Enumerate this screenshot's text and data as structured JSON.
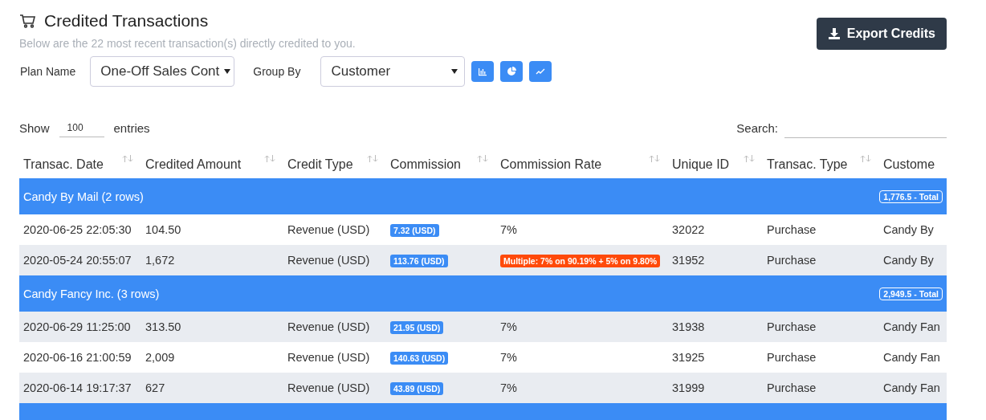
{
  "header": {
    "title": "Credited Transactions",
    "subtitle": "Below are the 22 most recent transaction(s) directly credited to you.",
    "export_button": "Export Credits"
  },
  "filters": {
    "plan_label": "Plan Name",
    "plan_value": "One-Off Sales Cont",
    "group_label": "Group By",
    "group_value": "Customer"
  },
  "table_controls": {
    "show_label": "Show",
    "entries_value": "100",
    "entries_label": "entries",
    "search_label": "Search:"
  },
  "table": {
    "columns": [
      "Transac. Date",
      "Credited Amount",
      "Credit Type",
      "Commission",
      "Commission Rate",
      "Unique ID",
      "Transac. Type",
      "Custome"
    ],
    "groups": [
      {
        "title": "Candy By Mail (2 rows)",
        "total": "1,776.5 - Total",
        "rows": [
          {
            "date": "2020-06-25 22:05:30",
            "amount": "104.50",
            "credit_type": "Revenue (USD)",
            "commission": "7.32 (USD)",
            "rate": {
              "kind": "plain",
              "text": "7%"
            },
            "unique_id": "32022",
            "type": "Purchase",
            "customer": "Candy By"
          },
          {
            "date": "2020-05-24 20:55:07",
            "amount": "1,672",
            "credit_type": "Revenue (USD)",
            "commission": "113.76 (USD)",
            "rate": {
              "kind": "badge",
              "text": "Multiple: 7% on 90.19% + 5% on 9.80%"
            },
            "unique_id": "31952",
            "type": "Purchase",
            "customer": "Candy By"
          }
        ]
      },
      {
        "title": "Candy Fancy Inc. (3 rows)",
        "total": "2,949.5 - Total",
        "rows": [
          {
            "date": "2020-06-29 11:25:00",
            "amount": "313.50",
            "credit_type": "Revenue (USD)",
            "commission": "21.95 (USD)",
            "rate": {
              "kind": "plain",
              "text": "7%"
            },
            "unique_id": "31938",
            "type": "Purchase",
            "customer": "Candy Fan"
          },
          {
            "date": "2020-06-16 21:00:59",
            "amount": "2,009",
            "credit_type": "Revenue (USD)",
            "commission": "140.63 (USD)",
            "rate": {
              "kind": "plain",
              "text": "7%"
            },
            "unique_id": "31925",
            "type": "Purchase",
            "customer": "Candy Fan"
          },
          {
            "date": "2020-06-14 19:17:37",
            "amount": "627",
            "credit_type": "Revenue (USD)",
            "commission": "43.89 (USD)",
            "rate": {
              "kind": "plain",
              "text": "7%"
            },
            "unique_id": "31999",
            "type": "Purchase",
            "customer": "Candy Fan"
          }
        ]
      }
    ]
  }
}
